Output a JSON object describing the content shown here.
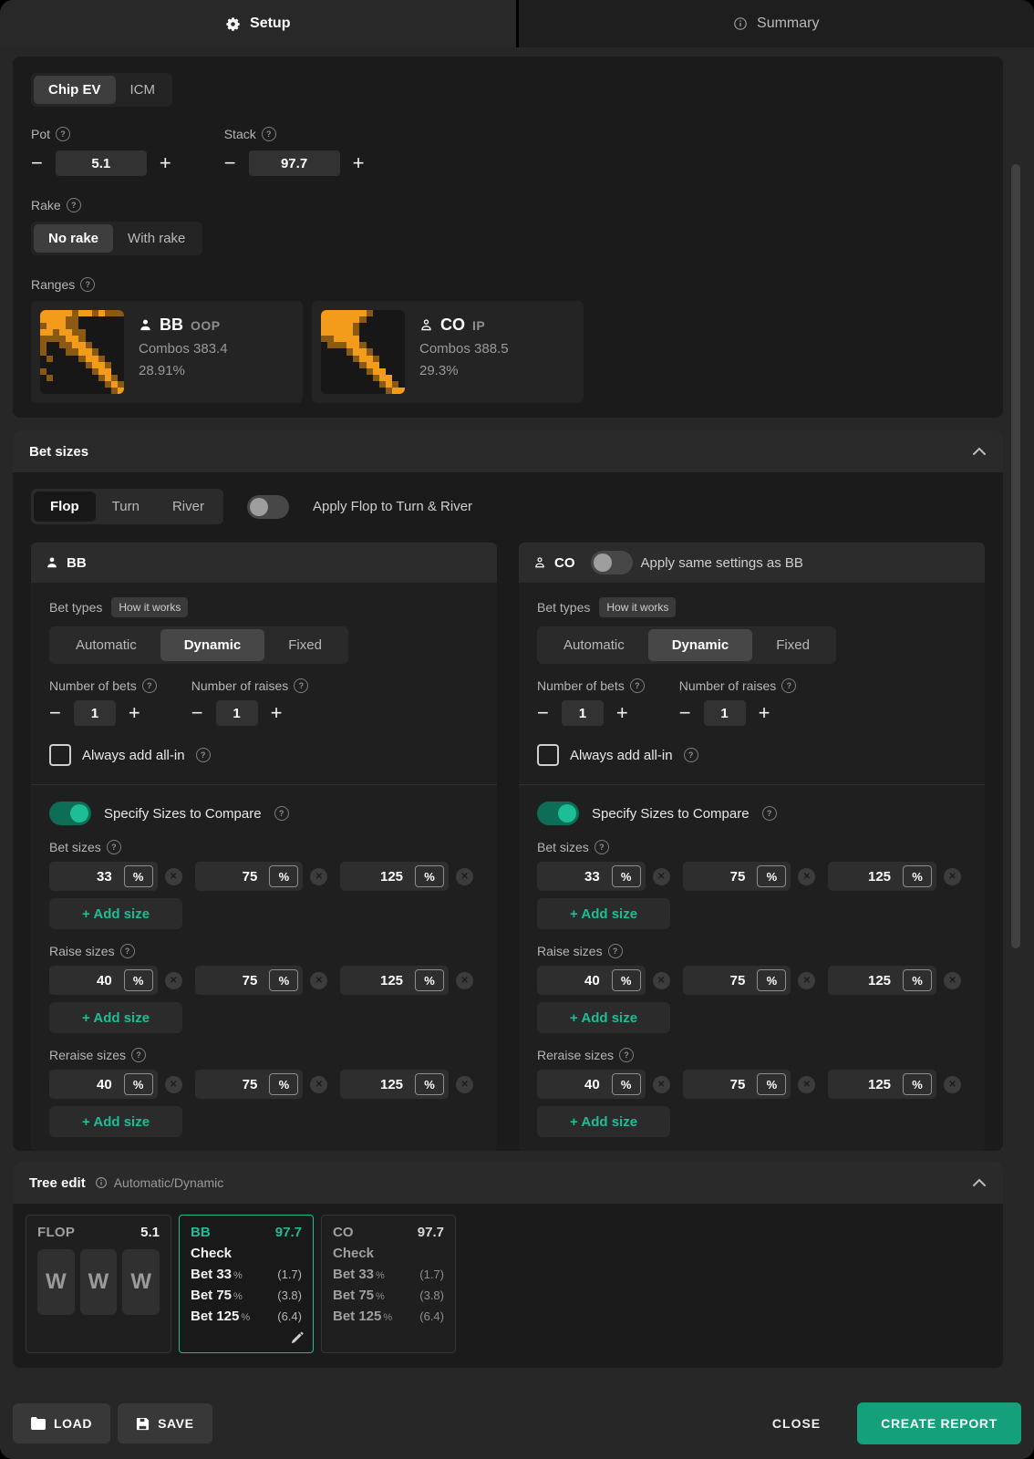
{
  "colors": {
    "accent": "#1dbd96",
    "accent_button": "#14a07b",
    "orange": "#f39c1c"
  },
  "glyphs": {
    "minus": "−",
    "plus": "+",
    "close": "✕"
  },
  "tabs": {
    "setup": {
      "label": "Setup"
    },
    "summary": {
      "label": "Summary"
    }
  },
  "setup": {
    "mode": {
      "options": [
        "Chip EV",
        "ICM"
      ],
      "selected": "Chip EV"
    },
    "pot": {
      "label": "Pot",
      "value": "5.1"
    },
    "stack": {
      "label": "Stack",
      "value": "97.7"
    },
    "rake": {
      "label": "Rake",
      "options": [
        "No rake",
        "With rake"
      ],
      "selected": "No rake"
    },
    "ranges": {
      "label": "Ranges",
      "players": [
        {
          "name": "BB",
          "position": "OOP",
          "combos": "Combos 383.4",
          "percent": "28.91%",
          "grid": [
            "2222212212111",
            "2222110000000",
            "1222110000000",
            "2212211000000",
            "1111221000000",
            "1001122100000",
            "1000112210000",
            "0100001221000",
            "0000000122100",
            "1000000012200",
            "0100000001210",
            "0000000000121",
            "0000000000012"
          ]
        },
        {
          "name": "CO",
          "position": "IP",
          "combos": "Combos 388.5",
          "percent": "29.3%",
          "grid": [
            "2222222100000",
            "2222221000000",
            "2222210000000",
            "2222210000000",
            "1122220000000",
            "0111221000000",
            "0000122100000",
            "0000012210000",
            "0000001220000",
            "0000000122000",
            "0000000012200",
            "0000000001210",
            "0000000000122"
          ]
        }
      ]
    }
  },
  "bet_sizes_section": {
    "title": "Bet sizes",
    "streets": [
      "Flop",
      "Turn",
      "River"
    ],
    "selected_street": "Flop",
    "apply_flop_label": "Apply Flop to Turn & River",
    "panel_labels": {
      "bet_types": "Bet types",
      "how_it_works": "How it works",
      "types": [
        "Automatic",
        "Dynamic",
        "Fixed"
      ],
      "selected_type": "Dynamic",
      "number_of_bets": "Number of bets",
      "number_of_raises": "Number of raises",
      "bets_value": "1",
      "raises_value": "1",
      "always_add_allin": "Always add all-in",
      "specify_sizes": "Specify Sizes to Compare",
      "add_size": "+ Add size",
      "percent": "%"
    },
    "size_groups": [
      {
        "label": "Bet sizes",
        "sizes": [
          "33",
          "75",
          "125"
        ]
      },
      {
        "label": "Raise sizes",
        "sizes": [
          "40",
          "75",
          "125"
        ]
      },
      {
        "label": "Reraise sizes",
        "sizes": [
          "40",
          "75",
          "125"
        ]
      }
    ],
    "panels": [
      {
        "name": "BB"
      },
      {
        "name": "CO",
        "toggle_label": "Apply same settings as BB"
      }
    ]
  },
  "tree_edit": {
    "title": "Tree edit",
    "subtitle": "Automatic/Dynamic",
    "nodes": [
      {
        "type": "flop",
        "label": "FLOP",
        "pot": "5.1",
        "cards": [
          "W",
          "W",
          "W"
        ]
      },
      {
        "type": "player",
        "name": "BB",
        "stack": "97.7",
        "selected": true,
        "actions": [
          {
            "label": "Check",
            "pct": "",
            "amt": ""
          },
          {
            "label": "Bet 33",
            "pct": "%",
            "amt": "(1.7)"
          },
          {
            "label": "Bet 75",
            "pct": "%",
            "amt": "(3.8)"
          },
          {
            "label": "Bet 125",
            "pct": "%",
            "amt": "(6.4)"
          }
        ]
      },
      {
        "type": "player",
        "name": "CO",
        "stack": "97.7",
        "selected": false,
        "actions": [
          {
            "label": "Check",
            "pct": "",
            "amt": ""
          },
          {
            "label": "Bet 33",
            "pct": "%",
            "amt": "(1.7)"
          },
          {
            "label": "Bet 75",
            "pct": "%",
            "amt": "(3.8)"
          },
          {
            "label": "Bet 125",
            "pct": "%",
            "amt": "(6.4)"
          }
        ]
      }
    ]
  },
  "footer": {
    "load": "LOAD",
    "save": "SAVE",
    "close": "CLOSE",
    "create_report": "CREATE REPORT"
  }
}
